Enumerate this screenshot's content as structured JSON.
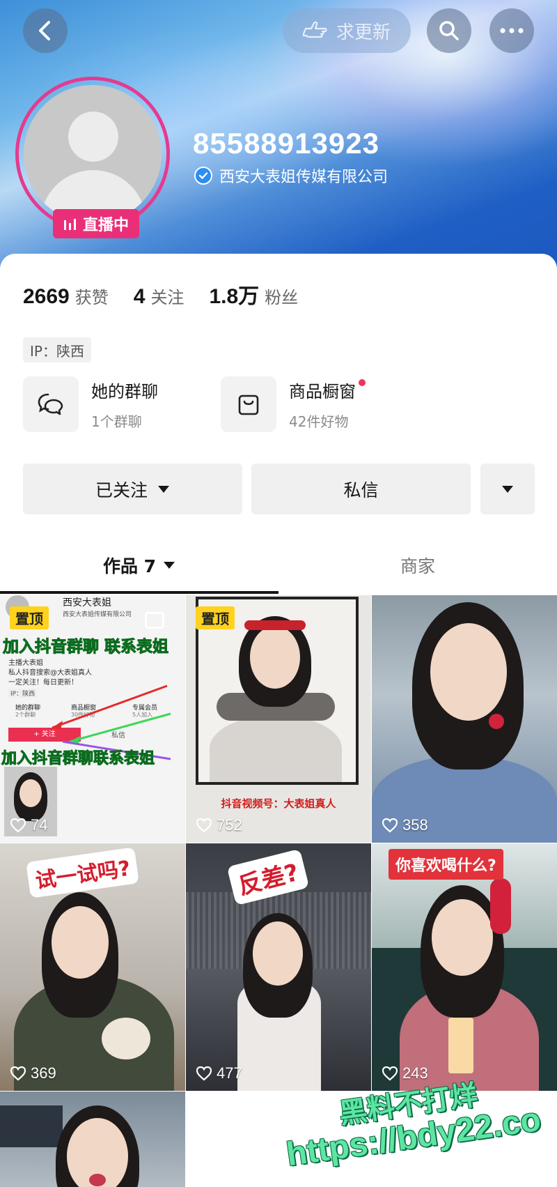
{
  "header": {
    "update_label": "求更新",
    "username": "85588913923",
    "company": "西安大表姐传媒有限公司",
    "live_label": "直播中"
  },
  "stats": [
    {
      "num": "2669",
      "label": "获赞"
    },
    {
      "num": "4",
      "label": "关注"
    },
    {
      "num": "1.8万",
      "label": "粉丝"
    }
  ],
  "ip": "IP：陕西",
  "entries": {
    "group": {
      "title": "她的群聊",
      "sub": "1个群聊"
    },
    "shop": {
      "title": "商品橱窗",
      "sub": "42件好物"
    }
  },
  "actions": {
    "followed": "已关注",
    "message": "私信"
  },
  "tabs": {
    "works": "作品 7",
    "merchant": "商家"
  },
  "videos": [
    {
      "likes": "74",
      "pinned": "置顶",
      "texts": [
        "西安大表姐",
        "西安大表姐传媒有限公司",
        "加入抖音群聊 联系表姐",
        "主播大表姐",
        "私人抖音搜索@大表姐真人",
        "一定关注！每日更新！",
        "IP：陕西",
        "她的群聊",
        "2个群聊",
        "商品橱窗",
        "30件好物",
        "专属会员",
        "5人加入",
        "+ 关注",
        "私信",
        "加入抖音群聊联系表姐"
      ]
    },
    {
      "likes": "752",
      "pinned": "置顶",
      "texts": [
        "抖音视频号：大表姐真人"
      ]
    },
    {
      "likes": "358"
    },
    {
      "likes": "369",
      "texts": [
        "试一试吗?"
      ]
    },
    {
      "likes": "477",
      "texts": [
        "反差?"
      ]
    },
    {
      "likes": "243",
      "texts": [
        "你喜欢喝什么?"
      ]
    },
    {}
  ],
  "watermark": {
    "line1": "黑料不打烊",
    "line2": "https://bdy22.co"
  },
  "colors": {
    "live": "#ea2f79",
    "accent_blue": "#2d8df0",
    "pin": "#ffd21e",
    "dot": "#f3345c"
  }
}
